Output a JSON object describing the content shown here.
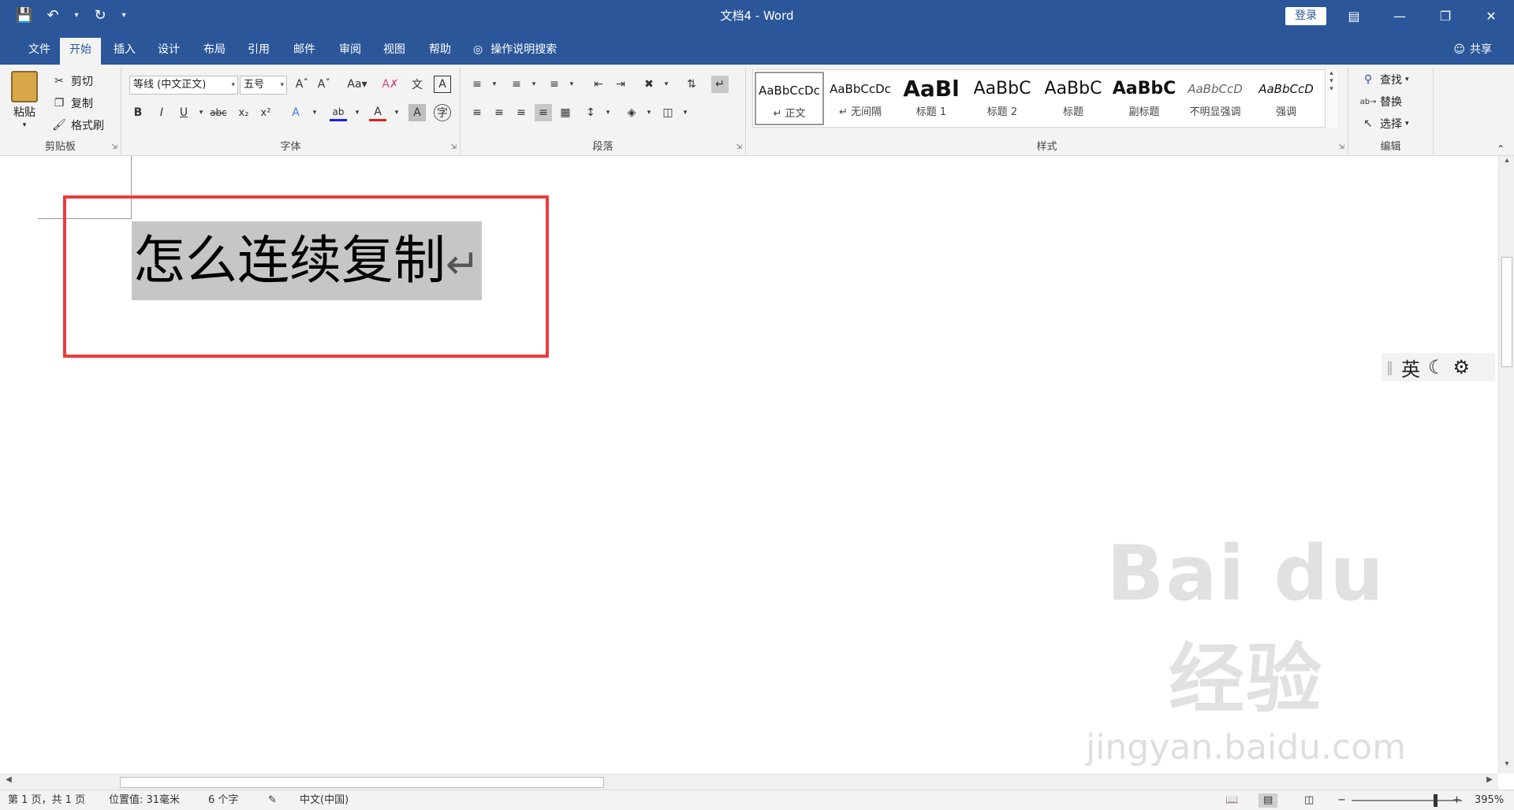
{
  "titlebar": {
    "title": "文档4 - Word",
    "login_label": "登录",
    "qat_icons": [
      "save-icon",
      "undo-icon",
      "redo-icon",
      "customize-icon"
    ]
  },
  "tabs": [
    "文件",
    "开始",
    "插入",
    "设计",
    "布局",
    "引用",
    "邮件",
    "审阅",
    "视图",
    "帮助"
  ],
  "active_tab": "开始",
  "tell_me": "操作说明搜索",
  "share_label": "共享",
  "clipboard": {
    "paste": "粘贴",
    "cut": "剪切",
    "copy": "复制",
    "format_painter": "格式刷",
    "group": "剪贴板"
  },
  "font": {
    "name": "等线 (中文正文)",
    "size": "五号",
    "group": "字体"
  },
  "paragraph": {
    "group": "段落"
  },
  "styles": {
    "group": "样式",
    "items": [
      {
        "sample": "AaBbCcDc",
        "name": "↵ 正文"
      },
      {
        "sample": "AaBbCcDc",
        "name": "↵ 无间隔"
      },
      {
        "sample": "AaBl",
        "name": "标题 1"
      },
      {
        "sample": "AaBbC",
        "name": "标题 2"
      },
      {
        "sample": "AaBbC",
        "name": "标题"
      },
      {
        "sample": "AaBbC",
        "name": "副标题"
      },
      {
        "sample": "AaBbCcD",
        "name": "不明显强调"
      },
      {
        "sample": "AaBbCcD",
        "name": "强调"
      }
    ]
  },
  "editing": {
    "find": "查找",
    "replace": "替换",
    "select": "选择",
    "group": "编辑"
  },
  "document": {
    "selected_text": "怎么连续复制",
    "paragraph_mark": "↵"
  },
  "ime": {
    "lang": "英"
  },
  "watermark": {
    "brand": "Bai du 经验",
    "url": "jingyan.baidu.com"
  },
  "status": {
    "page": "第 1 页，共 1 页",
    "position": "位置值: 31毫米",
    "words": "6 个字",
    "language": "中文(中国)",
    "zoom": "395%"
  }
}
